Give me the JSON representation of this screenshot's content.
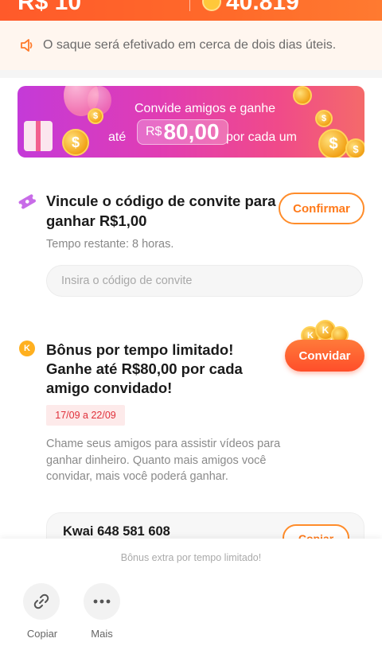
{
  "header": {
    "balance": "R$ 10",
    "coins": "40.819"
  },
  "notice": {
    "text": "O saque será efetivado em cerca de dois dias úteis."
  },
  "banner": {
    "line1": "Convide amigos e ganhe",
    "prefix": "até",
    "currency": "R$",
    "amount": "80,00",
    "suffix": "por cada um"
  },
  "invite_code": {
    "title": "Vincule o código de convite para ganhar R$1,00",
    "confirm_label": "Confirmar",
    "remaining": "Tempo restante: 8 horas.",
    "placeholder": "Insira o código de convite"
  },
  "bonus": {
    "badge_letter": "K",
    "title": "Bônus por tempo limitado! Ganhe até R$80,00 por cada amigo convidado!",
    "invite_label": "Convidar",
    "date_range": "17/09 a 22/09",
    "description": "Chame seus amigos para assistir vídeos para ganhar dinheiro. Quanto mais amigos você convidar, mais você poderá ganhar.",
    "kwai_id": "Kwai 648 581 608",
    "copy_label": "Copiar"
  },
  "share_sheet": {
    "title": "Bônus extra por tempo limitado!",
    "items": [
      {
        "label": "Copiar",
        "icon": "link-icon"
      },
      {
        "label": "Mais",
        "icon": "more-icon"
      }
    ]
  },
  "colors": {
    "accent": "#ff5a2a",
    "button_outline": "#ff8c2a",
    "date_badge": "#e0303a"
  }
}
